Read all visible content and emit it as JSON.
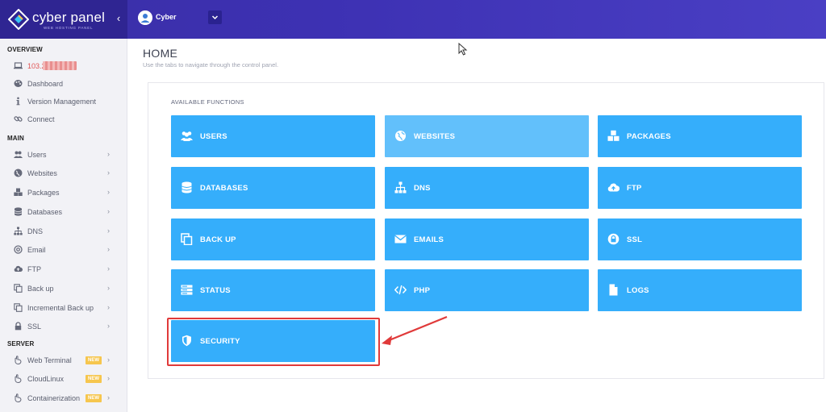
{
  "brand": {
    "name": "cyber panel",
    "tagline": "WEB HOSTING PANEL"
  },
  "topbar": {
    "user_name": "Cyber"
  },
  "sidebar": {
    "overview_title": "OVERVIEW",
    "main_title": "MAIN",
    "server_title": "SERVER",
    "overview_items": [
      {
        "label": "103.2",
        "icon": "laptop-icon"
      },
      {
        "label": "Dashboard",
        "icon": "palette-icon"
      },
      {
        "label": "Version Management",
        "icon": "info-icon"
      },
      {
        "label": "Connect",
        "icon": "link-icon"
      }
    ],
    "main_items": [
      {
        "label": "Users",
        "icon": "users-icon"
      },
      {
        "label": "Websites",
        "icon": "globe-icon"
      },
      {
        "label": "Packages",
        "icon": "cubes-icon"
      },
      {
        "label": "Databases",
        "icon": "database-icon"
      },
      {
        "label": "DNS",
        "icon": "sitemap-icon"
      },
      {
        "label": "Email",
        "icon": "at-icon"
      },
      {
        "label": "FTP",
        "icon": "cloud-upload-icon"
      },
      {
        "label": "Back up",
        "icon": "copy-icon"
      },
      {
        "label": "Incremental Back up",
        "icon": "copy-icon"
      },
      {
        "label": "SSL",
        "icon": "lock-icon"
      }
    ],
    "server_items": [
      {
        "label": "Web Terminal",
        "icon": "hand-icon",
        "badge": "NEW"
      },
      {
        "label": "CloudLinux",
        "icon": "hand-icon",
        "badge": "NEW"
      },
      {
        "label": "Containerization",
        "icon": "hand-icon",
        "badge": "NEW"
      }
    ]
  },
  "main": {
    "title": "HOME",
    "subtitle": "Use the tabs to navigate through the control panel.",
    "functions_label": "AVAILABLE FUNCTIONS",
    "functions": [
      {
        "label": "USERS",
        "icon": "users-icon"
      },
      {
        "label": "WEBSITES",
        "icon": "globe-icon"
      },
      {
        "label": "PACKAGES",
        "icon": "cubes-icon"
      },
      {
        "label": "DATABASES",
        "icon": "database-icon"
      },
      {
        "label": "DNS",
        "icon": "sitemap-icon"
      },
      {
        "label": "FTP",
        "icon": "cloud-upload-icon"
      },
      {
        "label": "BACK UP",
        "icon": "copy-icon"
      },
      {
        "label": "EMAILS",
        "icon": "envelope-icon"
      },
      {
        "label": "SSL",
        "icon": "lock-icon"
      },
      {
        "label": "STATUS",
        "icon": "server-icon"
      },
      {
        "label": "PHP",
        "icon": "code-icon"
      },
      {
        "label": "LOGS",
        "icon": "file-icon"
      },
      {
        "label": "SECURITY",
        "icon": "shield-icon"
      }
    ]
  },
  "colors": {
    "topbar": "#3d31b3",
    "card": "#35aefb",
    "card_hover": "#62c0fb",
    "highlight": "#e03a3a",
    "badge": "#f6c64e"
  }
}
